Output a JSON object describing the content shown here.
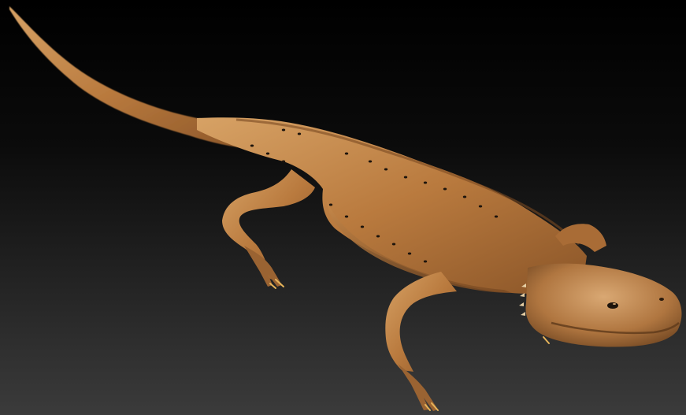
{
  "scene": {
    "subject": "lizard-render",
    "background_top": "#000000",
    "background_bottom": "#3b3b3b",
    "skin_base": "#b97a3e",
    "skin_light": "#d7a265",
    "skin_dark": "#6e4420",
    "claw_color": "#e6b45a",
    "spot_color": "#1d140c"
  }
}
